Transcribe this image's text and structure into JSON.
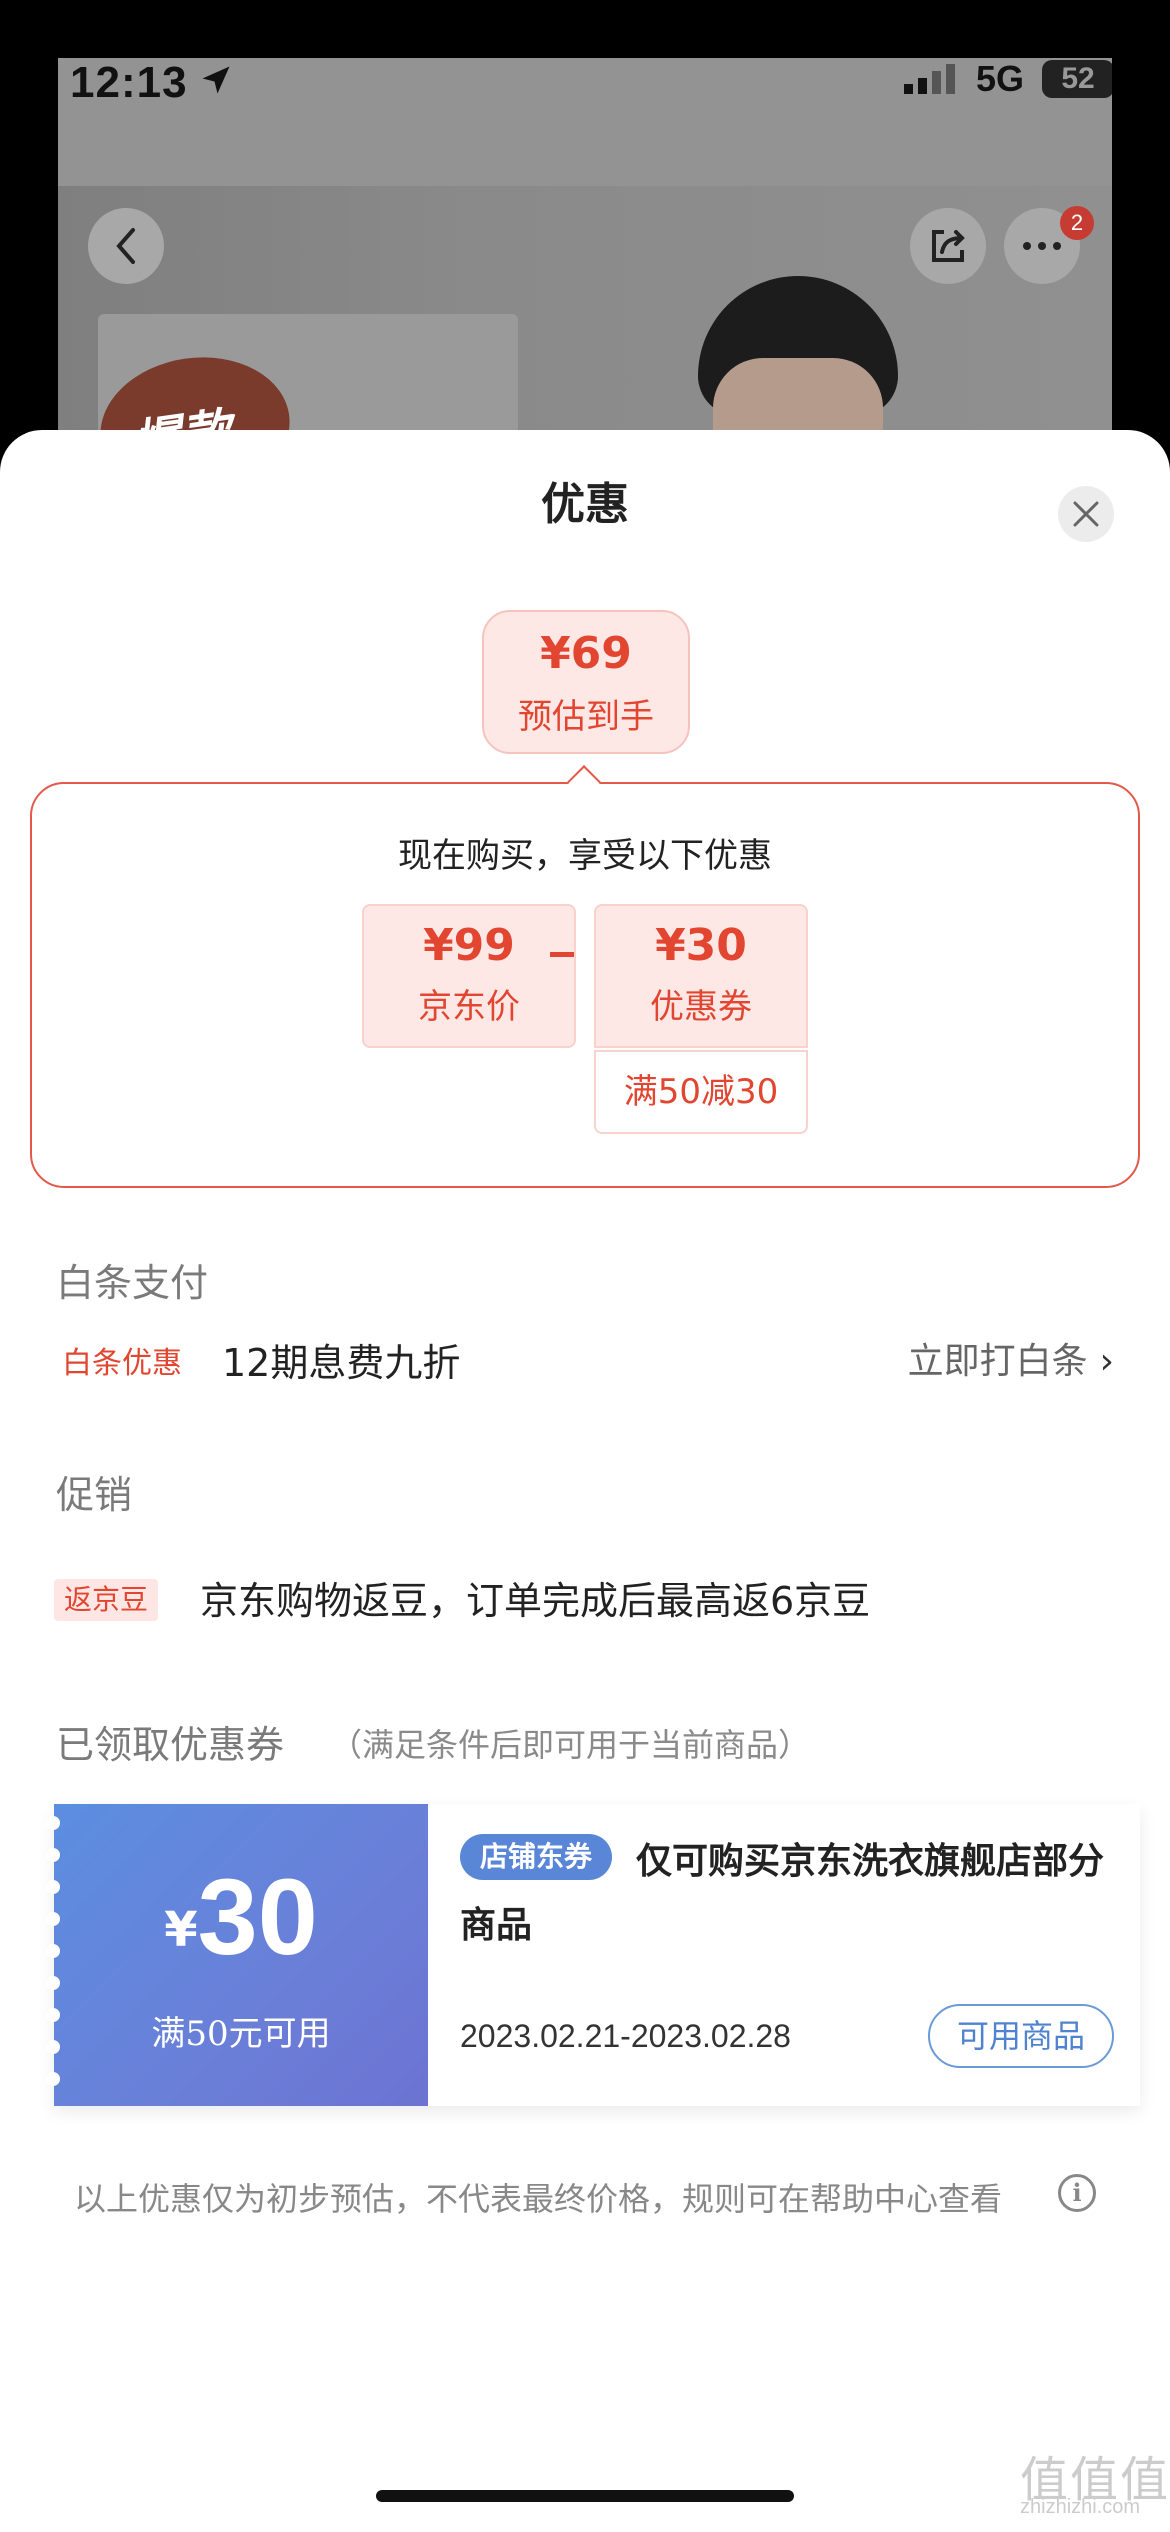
{
  "status_bar": {
    "time": "12:13",
    "network": "5G",
    "battery": "52"
  },
  "background_page": {
    "badge_text": "爆款",
    "more_badge_count": "2"
  },
  "sheet": {
    "title": "优惠",
    "estimate": {
      "price": "¥69",
      "label": "预估到手"
    },
    "breakdown": {
      "heading": "现在购买，享受以下优惠",
      "jd_price": {
        "value": "¥99",
        "label": "京东价"
      },
      "coupon": {
        "value": "¥30",
        "label": "优惠券",
        "condition": "满50减30"
      }
    },
    "baitiao": {
      "section_title": "白条支付",
      "tag": "白条优惠",
      "text": "12期息费九折",
      "link": "立即打白条",
      "chevron": "›"
    },
    "promo": {
      "section_title": "促销",
      "tag": "返京豆",
      "text": "京东购物返豆，订单完成后最高返6京豆"
    },
    "coupons": {
      "section_title": "已领取优惠券",
      "note": "（满足条件后即可用于当前商品）",
      "items": [
        {
          "yen": "¥",
          "amount": "30",
          "condition": "满50元可用",
          "shop_tag": "店铺东券",
          "description": "仅可购买京东洗衣旗舰店部分商品",
          "date_range": "2023.02.21-2023.02.28",
          "button": "可用商品"
        }
      ]
    },
    "disclaimer": "以上优惠仅为初步预估，不代表最终价格，规则可在帮助中心查看"
  },
  "watermark": {
    "logo": "值值值",
    "url": "zhizhizhi.com"
  },
  "colors": {
    "accent_red": "#e24630",
    "coupon_blue": "#5b8ee0",
    "bubble_bg": "#fde8e6"
  }
}
